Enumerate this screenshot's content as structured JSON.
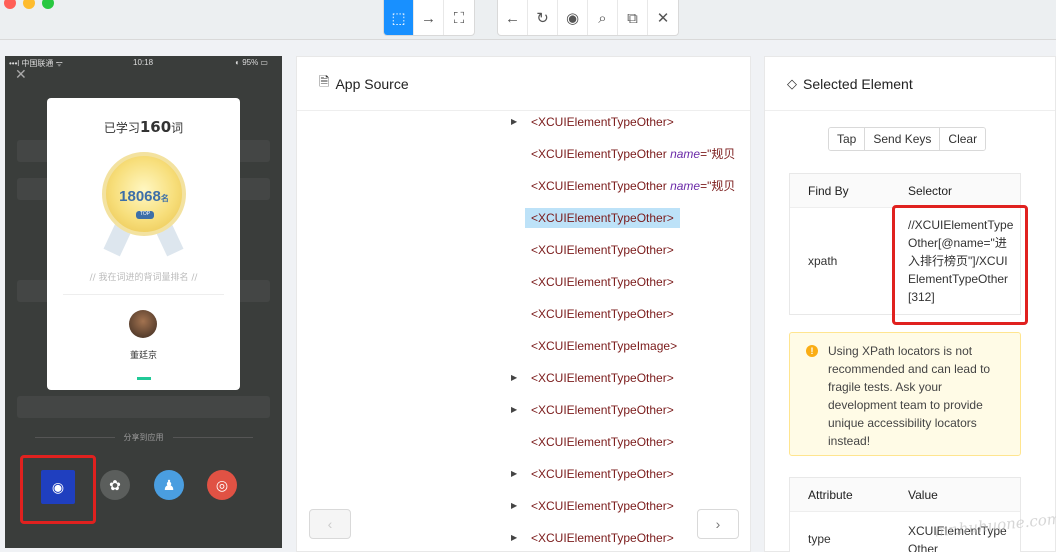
{
  "toolbar": {
    "buttons_left": [
      {
        "name": "select-elements-icon",
        "glyph": "⬚",
        "active": true
      },
      {
        "name": "swipe-icon",
        "glyph": "→",
        "active": false
      },
      {
        "name": "tap-by-coordinates-icon",
        "glyph": "⛶",
        "active": false
      }
    ],
    "buttons_right": [
      {
        "name": "back-icon",
        "glyph": "←"
      },
      {
        "name": "refresh-icon",
        "glyph": "↻"
      },
      {
        "name": "eye-icon",
        "glyph": "◉"
      },
      {
        "name": "search-icon",
        "glyph": "⌕"
      },
      {
        "name": "copy-icon",
        "glyph": "⧉"
      },
      {
        "name": "close-icon",
        "glyph": "✕"
      }
    ]
  },
  "phone": {
    "status": {
      "carrier": "•••l 中国联通 ᯤ",
      "time": "10:18",
      "battery": "◐ 95% ▭"
    },
    "card": {
      "title_pre": "已学习",
      "title_num": "160",
      "title_post": "词",
      "medal_number": "18068",
      "medal_unit": "名",
      "medal_tag": "TOP",
      "subtitle": "// 我在词进的背词量排名 //",
      "user_name": "董廷京"
    },
    "share_label": "分享到应用"
  },
  "app_source": {
    "title": "App Source",
    "rows": [
      {
        "indent": 234,
        "arrow": true,
        "tag": "<XCUIElementTypeOther>",
        "attr": "",
        "aval": "",
        "selected": false
      },
      {
        "indent": 234,
        "arrow": false,
        "tag": "<XCUIElementTypeOther ",
        "attr": "name",
        "aval": "=\"规贝",
        "selected": false
      },
      {
        "indent": 234,
        "arrow": false,
        "tag": "<XCUIElementTypeOther ",
        "attr": "name",
        "aval": "=\"规贝",
        "selected": false
      },
      {
        "indent": 234,
        "arrow": false,
        "tag": "<XCUIElementTypeOther>",
        "attr": "",
        "aval": "",
        "selected": true
      },
      {
        "indent": 234,
        "arrow": false,
        "tag": "<XCUIElementTypeOther>",
        "attr": "",
        "aval": "",
        "selected": false
      },
      {
        "indent": 234,
        "arrow": false,
        "tag": "<XCUIElementTypeOther>",
        "attr": "",
        "aval": "",
        "selected": false
      },
      {
        "indent": 234,
        "arrow": false,
        "tag": "<XCUIElementTypeOther>",
        "attr": "",
        "aval": "",
        "selected": false
      },
      {
        "indent": 234,
        "arrow": false,
        "tag": "<XCUIElementTypeImage>",
        "attr": "",
        "aval": "",
        "selected": false
      },
      {
        "indent": 234,
        "arrow": true,
        "tag": "<XCUIElementTypeOther>",
        "attr": "",
        "aval": "",
        "selected": false
      },
      {
        "indent": 234,
        "arrow": true,
        "tag": "<XCUIElementTypeOther>",
        "attr": "",
        "aval": "",
        "selected": false
      },
      {
        "indent": 234,
        "arrow": false,
        "tag": "<XCUIElementTypeOther>",
        "attr": "",
        "aval": "",
        "selected": false
      },
      {
        "indent": 234,
        "arrow": true,
        "tag": "<XCUIElementTypeOther>",
        "attr": "",
        "aval": "",
        "selected": false
      },
      {
        "indent": 234,
        "arrow": true,
        "tag": "<XCUIElementTypeOther>",
        "attr": "",
        "aval": "",
        "selected": false
      },
      {
        "indent": 234,
        "arrow": true,
        "tag": "<XCUIElementTypeOther>",
        "attr": "",
        "aval": "",
        "selected": false
      }
    ],
    "prev_glyph": "‹",
    "next_glyph": "›"
  },
  "selected_element": {
    "title": "Selected Element",
    "actions": [
      "Tap",
      "Send Keys",
      "Clear"
    ],
    "find_by_header": "Find By",
    "selector_header": "Selector",
    "strategy": "xpath",
    "selector": "//XCUIElementTypeOther[@name=\"进入排行榜页\"]/XCUIElementTypeOther[312]",
    "warning": "Using XPath locators is not recommended and can lead to fragile tests. Ask your development team to provide unique accessibility locators instead!",
    "attr_header": "Attribute",
    "value_header": "Value",
    "attr_name": "type",
    "attr_value": "XCUIElementTypeOther"
  },
  "watermark": "mr.huhuone.com"
}
